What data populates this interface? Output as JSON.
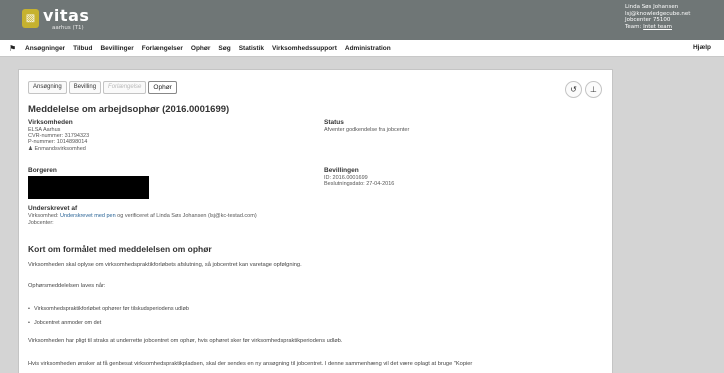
{
  "header": {
    "brand": "vitas",
    "brand_sub": "aarhus (T1)",
    "user": {
      "name": "Linda Søs Johansen",
      "email": "lsj@knowledgecube.net",
      "jobcenter": "Jobcenter 75100",
      "team_prefix": "Team:",
      "team_link": "Intet team"
    }
  },
  "nav": {
    "items": [
      "Ansøgninger",
      "Tilbud",
      "Bevillinger",
      "Forlængelser",
      "Ophør",
      "Søg",
      "Statistik",
      "Virksomhedssupport",
      "Administration"
    ],
    "help": "Hjælp"
  },
  "tabs": [
    {
      "label": "Ansøgning",
      "state": "normal"
    },
    {
      "label": "Bevilling",
      "state": "normal"
    },
    {
      "label": "Forlængelse",
      "state": "disabled"
    },
    {
      "label": "Ophør",
      "state": "active"
    }
  ],
  "page": {
    "title": "Meddelelse om arbejdsophør (2016.0001699)",
    "virksomheden": {
      "label": "Virksomheden",
      "name": "ELSA Aarhus",
      "cvr": "CVR-nummer: 31794323",
      "pnr": "P-nummer: 1014898014",
      "type": "Enmandsvirksomhed"
    },
    "status": {
      "label": "Status",
      "value": "Afventer godkendelse fra jobcenter"
    },
    "borgeren": {
      "label": "Borgeren"
    },
    "bevillingen": {
      "label": "Bevillingen",
      "id": "ID: 2016.0001699",
      "beslutning": "Beslutningsdato: 27-04-2016"
    },
    "underskrevet": {
      "label": "Underskrevet af",
      "prefix": "Virksomhed:",
      "link": "Underskrevet med pen",
      "suffix": "og verificeret af Linda Søs Johansen (lsj@kc-testad.com)",
      "jobcenter": "Jobcenter:"
    },
    "section_title": "Kort om formålet med meddelelsen om ophør",
    "para1": "Virksomheden skal oplyse om virksomhedspraktikforløbets afslutning, så jobcentret kan varetage opfølgning.",
    "para2": "Ophørsmeddelelsen laves når:",
    "bullets": [
      "Virksomhedspraktikforløbet ophører før tilskudsperiodens udløb",
      "Jobcentret anmoder om det"
    ],
    "para3": "Virksomheden har pligt til straks at underrette jobcentret om ophør, hvis ophøret sker før virksomhedspraktikperiodens udløb.",
    "para4": "Hvis virksomheden ønsker at få genbesat virksomhedspraktikpladsen, skal der sendes en ny ansøgning til jobcentret. I denne sammenhæng vil det være oplagt at bruge \"Kopier"
  }
}
